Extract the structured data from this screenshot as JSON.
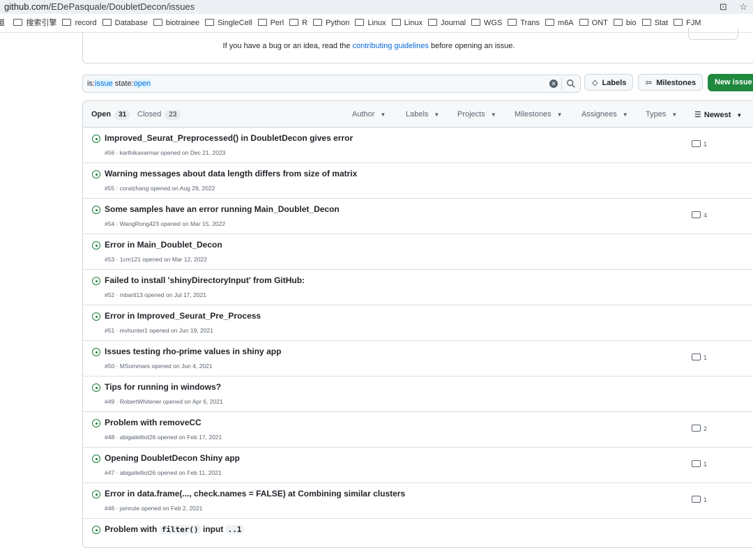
{
  "browser": {
    "url_host": "github.com",
    "url_path": "/EDePasquale/DoubletDecon/issues",
    "bookmarks_first": "道",
    "bookmarks": [
      "搜索引擎",
      "record",
      "Database",
      "biotrainee",
      "SingleCell",
      "Perl",
      "R",
      "Python",
      "Linux",
      "Linux",
      "Journal",
      "WGS",
      "Trans",
      "m6A",
      "ONT",
      "bio",
      "Stat",
      "FJM"
    ]
  },
  "banner": {
    "text_before": "If you have a bug or an idea, read the ",
    "link": "contributing guidelines",
    "text_after": " before opening an issue."
  },
  "search": {
    "prefix1": "is:",
    "value1": "issue",
    "middle": " state:",
    "value2": "open"
  },
  "buttons": {
    "labels": "Labels",
    "milestones": "Milestones",
    "new_issue": "New issue"
  },
  "tabs": {
    "open_label": "Open",
    "open_count": "31",
    "closed_label": "Closed",
    "closed_count": "23"
  },
  "filters": {
    "author": "Author",
    "labels": "Labels",
    "projects": "Projects",
    "milestones": "Milestones",
    "assignees": "Assignees",
    "types": "Types",
    "sort": "Newest"
  },
  "issues": [
    {
      "title": "Improved_Seurat_Preprocessed() in DoubletDecon gives error",
      "meta": "#56 · karthikavarmar opened on Dec 21, 2023",
      "comments": "1"
    },
    {
      "title": "Warning messages about data length differs from size of matrix",
      "meta": "#55 · coralzhang opened on Aug 29, 2022",
      "comments": ""
    },
    {
      "title": "Some samples have an error running Main_Doublet_Decon",
      "meta": "#54 · WangRong423 opened on Mar 15, 2022",
      "comments": "4"
    },
    {
      "title": "Error in Main_Doublet_Decon",
      "meta": "#53 · 1cm121 opened on Mar 12, 2022",
      "comments": ""
    },
    {
      "title": "Failed to install 'shinyDirectoryInput' from GitHub:",
      "meta": "#52 · mbartl13 opened on Jul 17, 2021",
      "comments": ""
    },
    {
      "title": "Error in Improved_Seurat_Pre_Process",
      "meta": "#51 · mvhunter1 opened on Jun 19, 2021",
      "comments": ""
    },
    {
      "title": "Issues testing rho-prime values in shiny app",
      "meta": "#50 · MSommars opened on Jun 4, 2021",
      "comments": "1"
    },
    {
      "title": "Tips for running in windows?",
      "meta": "#49 · RobertWhitener opened on Apr 6, 2021",
      "comments": ""
    },
    {
      "title": "Problem with removeCC",
      "meta": "#48 · abigailelliot26 opened on Feb 17, 2021",
      "comments": "2"
    },
    {
      "title": "Opening DoubletDecon Shiny app",
      "meta": "#47 · abigailelliot26 opened on Feb 11, 2021",
      "comments": "1"
    },
    {
      "title": "Error in data.frame(..., check.names = FALSE) at Combining similar clusters",
      "meta": "#46 · jamrute opened on Feb 2, 2021",
      "comments": "1"
    }
  ],
  "last_issue": {
    "t1": "Problem with ",
    "code1": "filter()",
    "t2": " input ",
    "code2": "..1"
  }
}
